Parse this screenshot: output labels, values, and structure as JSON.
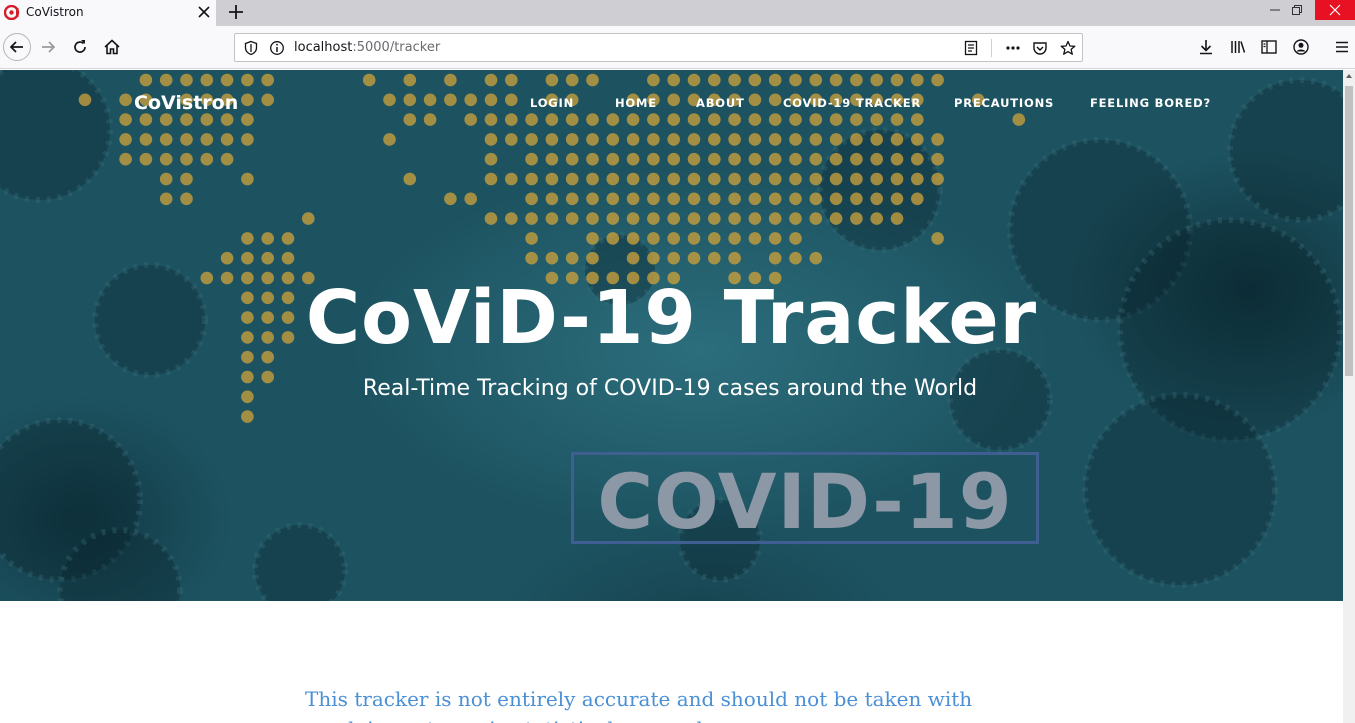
{
  "browser": {
    "tab_title": "CoVistron",
    "url_host": "localhost",
    "url_path": ":5000/tracker"
  },
  "site": {
    "brand": "CoVistron",
    "menu": [
      {
        "label": "LOGIN"
      },
      {
        "label": "HOME"
      },
      {
        "label": "ABOUT"
      },
      {
        "label": "COVID-19 TRACKER"
      },
      {
        "label": "PRECAUTIONS"
      },
      {
        "label": "FEELING BORED?"
      }
    ]
  },
  "hero": {
    "title": "CoViD-19 Tracker",
    "subtitle": "Real-Time Tracking of COVID-19 cases around the World",
    "badge_text": "COVID-19"
  },
  "notice": {
    "text": "This tracker is not entirely accurate and should not be taken with much importance in statistical research."
  },
  "colors": {
    "accent_link": "#4a90d6",
    "hero_bg": "#1d5361",
    "map_dots": "#c9a03c",
    "close_button": "#e81123"
  }
}
